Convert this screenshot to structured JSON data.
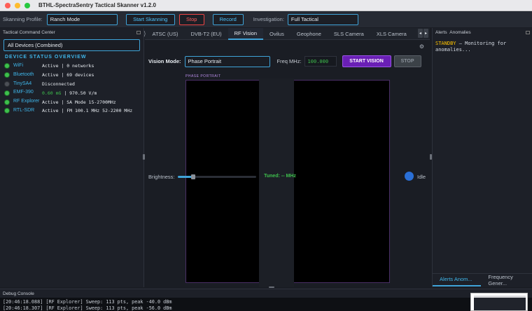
{
  "window": {
    "title": "BTHL-SpectraSentry Tactical Skanner v1.2.0"
  },
  "toolbar": {
    "profile_label": "Skanning Profile:",
    "profile_value": "Ranch Mode",
    "start_button": "Start Skanning",
    "stop_button": "Stop",
    "record_button": "Record",
    "investigation_label": "Investigation:",
    "investigation_value": "Full Tactical"
  },
  "left_panel": {
    "title": "Tactical Command Center",
    "device_select": "All Devices (Combined)",
    "section_title": "DEVICE STATUS OVERVIEW",
    "devices": [
      {
        "name": "WiFi",
        "status": "Active | 0 networks",
        "dot": "green"
      },
      {
        "name": "Bluetooth",
        "status": "Active | 69 devices",
        "dot": "green"
      },
      {
        "name": "TinySA4",
        "status": "Disconnected",
        "dot": "gray"
      },
      {
        "name": "EMF-390",
        "status_green": "0.60 mG",
        "status": " | 970.50 V/m",
        "dot": "green"
      },
      {
        "name": "RF Explorer",
        "status": "Active | SA Mode  15-2700MHz",
        "dot": "green"
      },
      {
        "name": "RTL-SDR",
        "status": "Active | FM 100.1 MHz  52-2200 MHz",
        "dot": "green"
      }
    ]
  },
  "tabs": {
    "items": [
      "ATSC (US)",
      "DVB-T2 (EU)",
      "RF Vision",
      "Ovilus",
      "Geophone",
      "SLS Camera",
      "XLS Camera"
    ],
    "active": "RF Vision"
  },
  "vision": {
    "mode_label": "Vision Mode:",
    "mode_value": "Phase Portrait",
    "freq_label": "Freq MHz:",
    "freq_value": "100.000",
    "start_button": "START VISION",
    "stop_button": "STOP",
    "canvas_label": "PHASE PORTRAIT",
    "brightness_label": "Brightness:",
    "brightness_level": 0.2,
    "tuned_text": "Tuned: -- MHz",
    "status_text": "Idle"
  },
  "alerts": {
    "header_left": "Alerts",
    "header_right": "Anomalies",
    "standby": "STANDBY",
    "message": " – Monitoring for anomalies...",
    "tab_active": "Alerts  Anom...",
    "tab_other": "Frequency Gener..."
  },
  "console": {
    "title": "Debug Console",
    "lines": [
      "[20:46:18.088] [RF Explorer] Sweep: 113 pts, peak -40.0 dBm",
      "[20:46:18.307] [RF Explorer] Sweep: 113 pts, peak -56.0 dBm"
    ]
  },
  "colors": {
    "accent": "#3fa3d8",
    "active_green": "#3ec04d",
    "alert_yellow": "#ffc400",
    "start_purple": "#6a1fb5",
    "stop_red": "#ff5c5c"
  }
}
